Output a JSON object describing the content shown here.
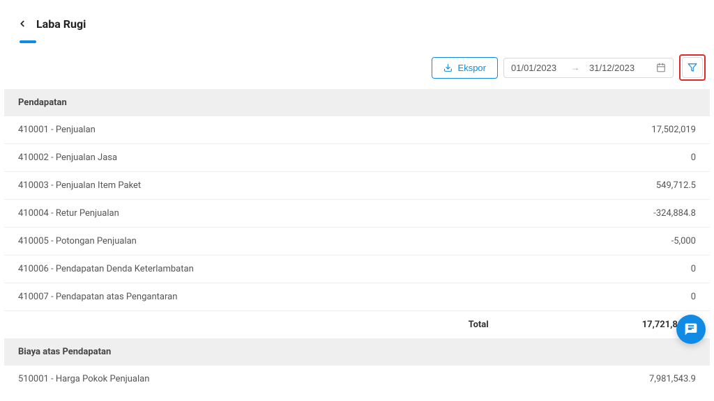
{
  "header": {
    "title": "Laba Rugi"
  },
  "toolbar": {
    "ekspor_label": "Ekspor",
    "date_from": "01/01/2023",
    "date_to": "31/12/2023"
  },
  "sections": [
    {
      "title": "Pendapatan",
      "rows": [
        {
          "label": "410001 - Penjualan",
          "value": "17,502,019"
        },
        {
          "label": "410002 - Penjualan Jasa",
          "value": "0"
        },
        {
          "label": "410003 - Penjualan Item Paket",
          "value": "549,712.5"
        },
        {
          "label": "410004 - Retur Penjualan",
          "value": "-324,884.8"
        },
        {
          "label": "410005 - Potongan Penjualan",
          "value": "-5,000"
        },
        {
          "label": "410006 - Pendapatan Denda Keterlambatan",
          "value": "0"
        },
        {
          "label": "410007 - Pendapatan atas Pengantaran",
          "value": "0"
        }
      ],
      "total_label": "Total",
      "total_value": "17,721,846.7"
    },
    {
      "title": "Biaya atas Pendapatan",
      "rows": [
        {
          "label": "510001 - Harga Pokok Penjualan",
          "value": "7,981,543.9"
        }
      ]
    }
  ]
}
